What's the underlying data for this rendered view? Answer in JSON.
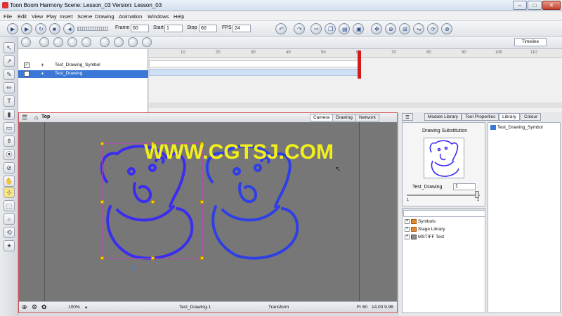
{
  "window": {
    "title": "Toon Boom Harmony Scene: Lesson_03 Version: Lesson_03",
    "minimize": "–",
    "maximize": "□",
    "close": "✕"
  },
  "menu": [
    "File",
    "Edit",
    "View",
    "Play",
    "Insert",
    "Scene",
    "Drawing",
    "Animation",
    "Windows",
    "Help"
  ],
  "toolbar": {
    "frame_label": "Frame",
    "frame_value": "60",
    "start_label": "Start",
    "start_value": "1",
    "stop_label": "Stop",
    "stop_value": "60",
    "fps_label": "FPS",
    "fps_value": "24"
  },
  "timeline": {
    "tab": "Timeline",
    "ruler": [
      "10",
      "20",
      "30",
      "40",
      "50",
      "60",
      "70",
      "80",
      "90",
      "100",
      "110"
    ],
    "layers": [
      {
        "name": "Test_Drawing_Symbol",
        "checked": "✓"
      },
      {
        "name": "Test_Drawing",
        "checked": "✓"
      }
    ],
    "current_frame": 60
  },
  "camera": {
    "view_name": "Top",
    "tabs": [
      "Camera",
      "Drawing",
      "Network"
    ],
    "zoom": "100%",
    "drawing_name": "Test_Drawing-1",
    "tool": "Transform",
    "frame": "Fr 60",
    "coords": "14.00 9.96"
  },
  "watermark": "WWW.CGTSJ.COM",
  "library": {
    "tabs": [
      "Module Library",
      "Tool Properties",
      "Library",
      "Colour"
    ],
    "substitution_title": "Drawing Substitution",
    "drawing_name": "Test_Drawing",
    "drawing_index": "1",
    "slider_min": "1",
    "slider_max": "1",
    "right_item": "Test_Drawing_Symbol",
    "tree": [
      "Symbols",
      "Stage Library",
      "MSTIFF Test"
    ]
  },
  "colors": {
    "accent": "#d21b1b",
    "sketch": "#3a2df0"
  }
}
